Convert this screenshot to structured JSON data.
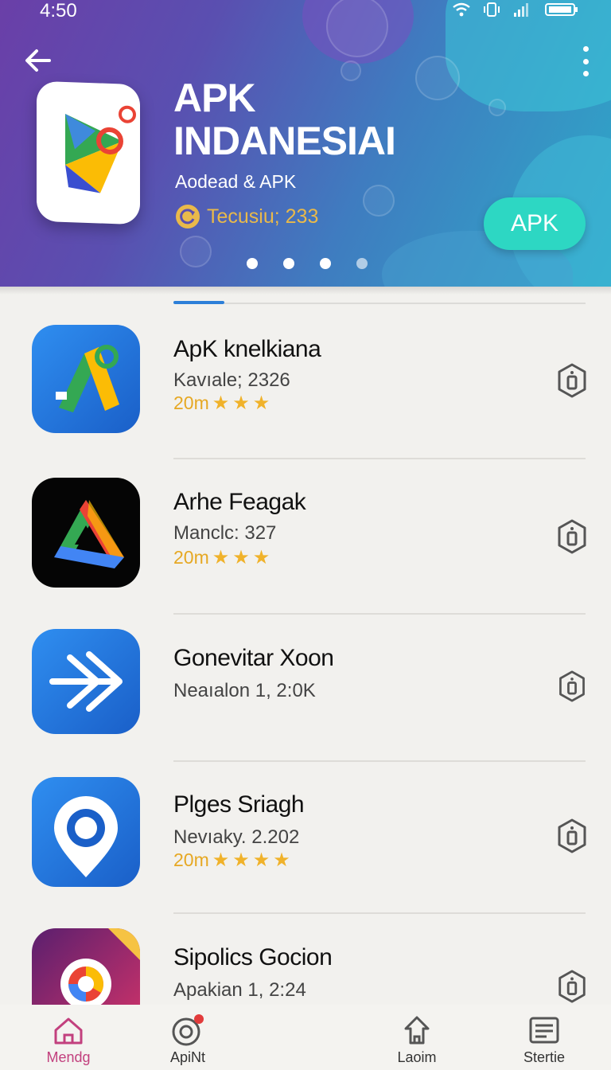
{
  "status_bar": {
    "time": "4:50"
  },
  "header": {
    "title": "APK INDANESIAI",
    "subtitle": "Aodead & APK",
    "rating_text": "Tecusiu; 233",
    "apk_button_label": "APK",
    "carousel_dots": 4,
    "active_dot": 0
  },
  "apps": [
    {
      "name": "ApK knelkiana",
      "meta": "Kavıale; 2326",
      "size": "20m",
      "stars": 3,
      "icon": "maps-pin-icon"
    },
    {
      "name": "Arhe Feagak",
      "meta": "Manclc: 327",
      "size": "20m",
      "stars": 3,
      "icon": "drive-triangle-icon"
    },
    {
      "name": "Gonevitar Xoon",
      "meta": "Neaıalon 1, 2:0K",
      "size": "",
      "stars": 0,
      "icon": "arrow-share-icon"
    },
    {
      "name": "Plges Sriagh",
      "meta": "Nevıaky. 2.202",
      "size": "20m",
      "stars": 4,
      "icon": "location-gear-icon"
    },
    {
      "name": "Sipolics Gocion",
      "meta": "Apakian 1, 2:24",
      "size": "",
      "stars": 0,
      "icon": "chrome-ring-icon"
    }
  ],
  "bottom_nav": [
    {
      "label": "Mendg",
      "icon": "home-icon",
      "active": true
    },
    {
      "label": "ApiNt",
      "icon": "target-icon",
      "active": false
    },
    {
      "label": "Laoim",
      "icon": "shop-icon",
      "active": false
    },
    {
      "label": "Stertie",
      "icon": "list-icon",
      "active": false
    }
  ],
  "colors": {
    "header_start": "#6a3fa8",
    "header_end": "#2ea9c8",
    "apk_button": "#2dd7c3",
    "star": "#f0b22a",
    "active_nav": "#c2407e",
    "tab_indicator": "#2d7fd8"
  }
}
